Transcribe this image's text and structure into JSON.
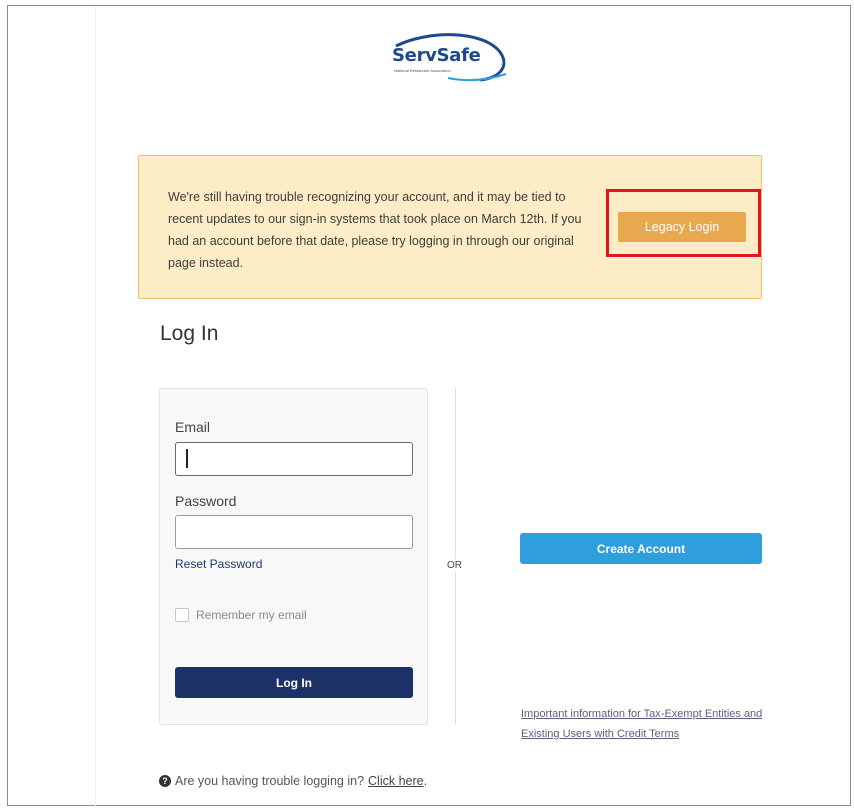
{
  "brand": {
    "name_part1": "Serv",
    "name_part2": "Safe",
    "tagline": "National Restaurant Association"
  },
  "alert": {
    "message": "We're still having trouble recognizing your account, and it may be tied to recent updates to our sign-in systems that took place on March 12th. If you had an account before that date, please try logging in through our original page instead.",
    "button_label": "Legacy Login"
  },
  "login": {
    "title": "Log In",
    "email_label": "Email",
    "email_value": "",
    "password_label": "Password",
    "password_value": "",
    "reset_link": "Reset Password",
    "remember_label": "Remember my email",
    "remember_checked": false,
    "submit_label": "Log In"
  },
  "separator": "OR",
  "signup": {
    "create_label": "Create Account",
    "tax_link": "Important information for Tax-Exempt Entities and Existing Users with Credit Terms"
  },
  "help": {
    "question": "Are you having trouble logging in?",
    "link": "Click here",
    "suffix": "."
  },
  "colors": {
    "alert_bg": "#fdedc7",
    "legacy_button": "#e8a84d",
    "highlight": "#e0161c",
    "login_button": "#1c3168",
    "create_button": "#2f9edc"
  },
  "icons": [
    "servsafe-logo",
    "help-circle-icon"
  ]
}
